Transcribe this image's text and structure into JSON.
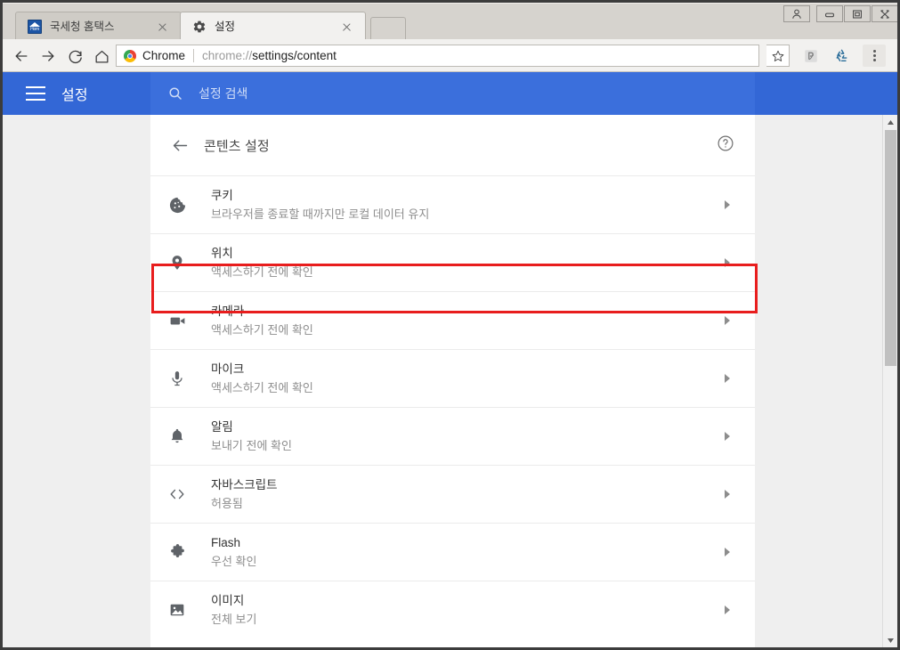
{
  "window": {
    "controls": [
      {
        "name": "user-profile-button",
        "icon": "person-icon"
      },
      {
        "name": "minimize-button",
        "icon": "minimize-icon"
      },
      {
        "name": "maximize-button",
        "icon": "restore-icon"
      },
      {
        "name": "close-button",
        "icon": "close-icon"
      }
    ]
  },
  "tabs": [
    {
      "title": "국세청 홈택스",
      "favicon": "hometax-favicon",
      "favicon_text": "Hom",
      "active": false,
      "close_label": "×"
    },
    {
      "title": "설정",
      "favicon": "gear-icon",
      "active": true,
      "close_label": "×"
    }
  ],
  "newtab": {
    "label": ""
  },
  "toolbar": {
    "back": "back-arrow-icon",
    "forward": "forward-arrow-icon",
    "reload": "reload-icon",
    "home": "home-icon",
    "omnibox": {
      "scheme_label": "Chrome",
      "url_prefix": "chrome://",
      "url_main": "settings/content",
      "full_url": "chrome://settings/content"
    },
    "star": "bookmark-star-icon",
    "extensions": [
      {
        "name": "pdf-extension-icon"
      },
      {
        "name": "recycle-extension-icon"
      }
    ],
    "menu": "three-dot-menu-icon"
  },
  "settings_bar": {
    "menu_icon": "hamburger-menu-icon",
    "title": "설정",
    "search": {
      "icon": "search-icon",
      "placeholder": "설정 검색",
      "value": ""
    }
  },
  "content": {
    "back_icon": "back-arrow-icon",
    "title": "콘텐츠 설정",
    "help_icon": "help-circle-icon"
  },
  "rows": [
    {
      "icon": "cookie-icon",
      "title": "쿠키",
      "sub": "브라우저를 종료할 때까지만 로컬 데이터 유지",
      "highlighted": true
    },
    {
      "icon": "location-pin-icon",
      "title": "위치",
      "sub": "액세스하기 전에 확인",
      "highlighted": false
    },
    {
      "icon": "camera-icon",
      "title": "카메라",
      "sub": "액세스하기 전에 확인",
      "highlighted": false
    },
    {
      "icon": "microphone-icon",
      "title": "마이크",
      "sub": "액세스하기 전에 확인",
      "highlighted": false
    },
    {
      "icon": "bell-icon",
      "title": "알림",
      "sub": "보내기 전에 확인",
      "highlighted": false
    },
    {
      "icon": "code-brackets-icon",
      "title": "자바스크립트",
      "sub": "허용됨",
      "highlighted": false
    },
    {
      "icon": "puzzle-piece-icon",
      "title": "Flash",
      "sub": "우선 확인",
      "highlighted": false
    },
    {
      "icon": "image-icon",
      "title": "이미지",
      "sub": "전체 보기",
      "highlighted": false
    }
  ],
  "colors": {
    "settings_blue": "#3367d6",
    "search_blue": "#3b6fdc",
    "highlight_red": "#e81d1d",
    "row_title": "#333333",
    "row_sub": "#8e8e8e",
    "page_bg": "#efefef"
  },
  "scrollbar": {
    "up_icon": "scroll-up-arrow-icon",
    "down_icon": "scroll-down-arrow-icon",
    "thumb": "scrollbar-thumb"
  }
}
